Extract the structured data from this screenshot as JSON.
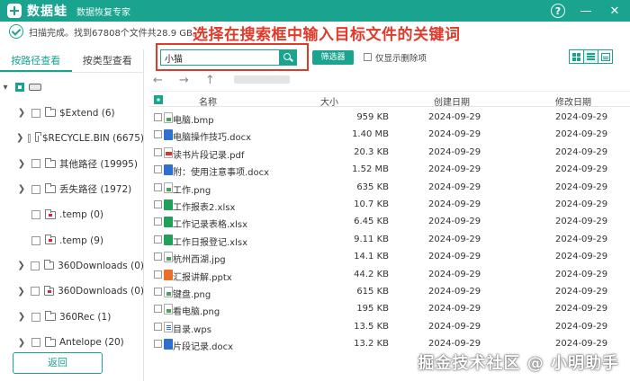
{
  "app": {
    "name": "数据蛙",
    "subtitle": "数据恢复专家"
  },
  "window_buttons": {
    "help": "?"
  },
  "status": {
    "text": "扫描完成。找到67808个文件共28.9 GB。"
  },
  "annotation": {
    "text": "选择在搜索框中输入目标文件的关键词"
  },
  "left_tabs": [
    {
      "label": "按路径查看",
      "active": true
    },
    {
      "label": "按类型查看",
      "active": false
    }
  ],
  "tree": [
    {
      "label": "",
      "type": "drive",
      "expanded": true,
      "checked": true
    },
    {
      "label": "$Extend (6)",
      "type": "folder"
    },
    {
      "label": "$RECYCLE.BIN (6675)",
      "type": "folder"
    },
    {
      "label": "其他路径 (19995)",
      "type": "folder"
    },
    {
      "label": "丢失路径 (1972)",
      "type": "folder"
    },
    {
      "label": ".temp (0)",
      "type": "folder-red"
    },
    {
      "label": ".temp (9)",
      "type": "folder-red"
    },
    {
      "label": "360Downloads (0)",
      "type": "folder"
    },
    {
      "label": "360Downloads (0)",
      "type": "folder-red"
    },
    {
      "label": "360Rec (1)",
      "type": "folder"
    },
    {
      "label": "Antelope (20)",
      "type": "folder"
    }
  ],
  "back_button": "返回",
  "search": {
    "value": "小猫"
  },
  "filter_button": "筛选器",
  "deleted_only": {
    "label": "仅显示删除项"
  },
  "table": {
    "headers": {
      "name": "名称",
      "size": "大小",
      "created": "创建日期",
      "modified": "修改日期"
    },
    "rows": [
      {
        "name": "电脑.bmp",
        "size": "959 KB",
        "created": "2024-09-29",
        "modified": "2024-09-29",
        "icon": "img"
      },
      {
        "name": "电脑操作技巧.docx",
        "size": "1.40 MB",
        "created": "2024-09-29",
        "modified": "2024-09-29",
        "icon": "doc"
      },
      {
        "name": "读书片段记录.pdf",
        "size": "20.3 KB",
        "created": "2024-09-29",
        "modified": "2024-09-29",
        "icon": "pdf"
      },
      {
        "name": "附：使用注意事项.docx",
        "size": "1.52 MB",
        "created": "2024-09-29",
        "modified": "2024-09-29",
        "icon": "doc"
      },
      {
        "name": "工作.png",
        "size": "635 KB",
        "created": "2024-09-29",
        "modified": "2024-09-29",
        "icon": "img"
      },
      {
        "name": "工作报表2.xlsx",
        "size": "10.7 KB",
        "created": "2024-09-29",
        "modified": "2024-09-29",
        "icon": "xls"
      },
      {
        "name": "工作记录表格.xlsx",
        "size": "6.45 KB",
        "created": "2024-09-29",
        "modified": "2024-09-29",
        "icon": "xls"
      },
      {
        "name": "工作日报登记.xlsx",
        "size": "9.11 KB",
        "created": "2024-09-29",
        "modified": "2024-09-29",
        "icon": "xls"
      },
      {
        "name": "杭州西湖.jpg",
        "size": "14.1 KB",
        "created": "2024-09-29",
        "modified": "2024-09-29",
        "icon": "img"
      },
      {
        "name": "汇报讲解.pptx",
        "size": "44.2 KB",
        "created": "2024-09-29",
        "modified": "2024-09-29",
        "icon": "ppt"
      },
      {
        "name": "键盘.png",
        "size": "615 KB",
        "created": "2024-09-29",
        "modified": "2024-09-29",
        "icon": "img"
      },
      {
        "name": "看电脑.png",
        "size": "195 KB",
        "created": "2024-09-29",
        "modified": "2024-09-29",
        "icon": "img"
      },
      {
        "name": "目录.wps",
        "size": "13.5 KB",
        "created": "2024-09-29",
        "modified": "2024-09-29",
        "icon": "wps"
      },
      {
        "name": "片段记录.docx",
        "size": "13.2 KB",
        "created": "2024-09-29",
        "modified": "2024-09-29",
        "icon": "doc"
      }
    ]
  },
  "watermark": "掘金技术社区 @ 小明助手",
  "colors": {
    "accent": "#1aa38f",
    "annotation": "#e03a2a"
  }
}
